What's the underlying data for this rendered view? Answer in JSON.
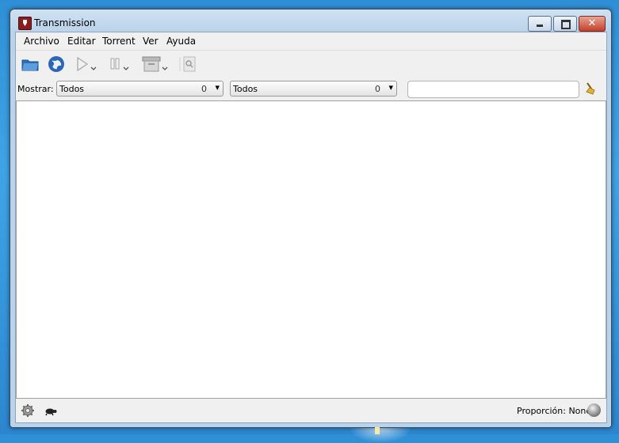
{
  "window": {
    "title": "Transmission"
  },
  "menu": {
    "items": [
      {
        "label": "Archivo"
      },
      {
        "label": "Editar"
      },
      {
        "label": "Torrent"
      },
      {
        "label": "Ver"
      },
      {
        "label": "Ayuda"
      }
    ]
  },
  "toolbar": {
    "icons": [
      "open-folder-icon",
      "globe-icon",
      "play-icon",
      "pause-icon",
      "remove-icon",
      "properties-icon"
    ]
  },
  "filter": {
    "show_label": "Mostrar:",
    "activity": {
      "selected": "Todos",
      "count": "0"
    },
    "tracker": {
      "selected": "Todos",
      "count": "0"
    },
    "search": {
      "value": "",
      "placeholder": ""
    }
  },
  "status": {
    "ratio": "Proporción: None"
  }
}
